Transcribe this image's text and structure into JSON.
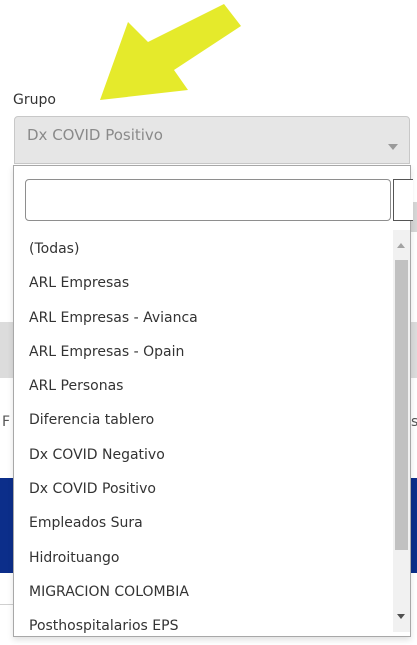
{
  "group": {
    "label": "Grupo",
    "selected_value": "Dx COVID Positivo"
  },
  "dropdown": {
    "search_value": "",
    "options": [
      "(Todas)",
      "ARL Empresas",
      "ARL Empresas - Avianca",
      "ARL Empresas - Opain",
      "ARL Personas",
      "Diferencia tablero",
      "Dx COVID Negativo",
      "Dx COVID Positivo",
      "Empleados Sura",
      "Hidroituango",
      "MIGRACION COLOMBIA",
      "Posthospitalarios EPS"
    ]
  },
  "background": {
    "left_fragment": "F",
    "right_fragment": "s"
  },
  "colors": {
    "arrow": "#e5ea2b",
    "header_blue": "#0c2e8a",
    "select_bg": "#e6e6e6"
  },
  "icons": {
    "arrow": "annotation-arrow-icon",
    "caret": "chevron-down-icon"
  }
}
